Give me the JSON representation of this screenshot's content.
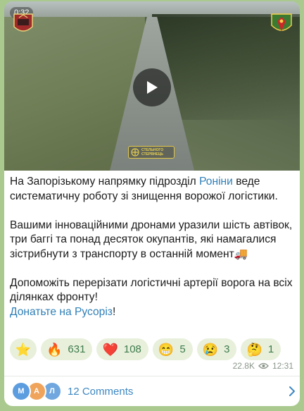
{
  "video": {
    "duration": "0:32",
    "watermark": [
      "СТЕЛЬНОГО",
      "СТЕРВНЕЦЬ"
    ]
  },
  "post": {
    "p1_before": "На Запорізькому напрямку підрозділ ",
    "p1_link": "Роніни",
    "p1_after": " веде систематичну роботу зі знищення ворожої логістики.",
    "p2": "Вашими інноваційними дронами уразили шість автівок, три баггі та понад десяток окупантів, які намагалися зістрибнути з транспорту в останній момент",
    "p2_emoji": "🚚",
    "p3": "Допоможіть перерізати логістичні артерії ворога на всіх ділянках фронту!",
    "p4_link": "Донатьте на Русоріз",
    "p4_after": "!"
  },
  "reactions": [
    {
      "emoji": "⭐",
      "count": ""
    },
    {
      "emoji": "🔥",
      "count": "631"
    },
    {
      "emoji": "❤️",
      "count": "108"
    },
    {
      "emoji": "😁",
      "count": "5"
    },
    {
      "emoji": "😢",
      "count": "3"
    },
    {
      "emoji": "🤔",
      "count": "1"
    }
  ],
  "meta": {
    "views": "22.8K",
    "time": "12:31"
  },
  "comments": {
    "label": "12 Comments",
    "avatars": [
      "М",
      "А",
      "Л"
    ]
  },
  "colors": {
    "background": "#a9c98f",
    "link": "#2f7fb7",
    "reaction_bg": "#e8f0dc",
    "reaction_text": "#3d7b4a"
  }
}
